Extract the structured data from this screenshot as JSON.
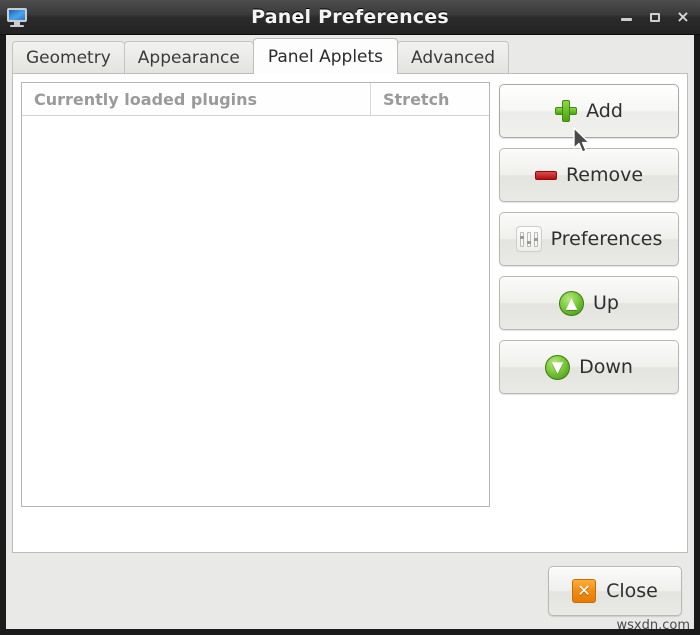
{
  "window": {
    "title": "Panel Preferences",
    "app_icon": "monitor-icon",
    "controls": [
      {
        "name": "minimize",
        "glyph": "minimize-icon"
      },
      {
        "name": "maximize",
        "glyph": "maximize-icon"
      },
      {
        "name": "close",
        "glyph": "close-icon",
        "label": "×"
      }
    ]
  },
  "tabs": [
    {
      "label": "Geometry",
      "active": false
    },
    {
      "label": "Appearance",
      "active": false
    },
    {
      "label": "Panel Applets",
      "active": true
    },
    {
      "label": "Advanced",
      "active": false
    }
  ],
  "plugin_list": {
    "columns": [
      {
        "label": "Currently loaded plugins"
      },
      {
        "label": "Stretch"
      }
    ],
    "rows": []
  },
  "side_buttons": [
    {
      "label": "Add",
      "icon": "plus-icon",
      "hovered": true
    },
    {
      "label": "Remove",
      "icon": "minus-icon",
      "hovered": false
    },
    {
      "label": "Preferences",
      "icon": "sliders-icon",
      "hovered": false
    },
    {
      "label": "Up",
      "icon": "arrow-up-circle-icon",
      "glyph": "▲",
      "hovered": false
    },
    {
      "label": "Down",
      "icon": "arrow-down-circle-icon",
      "glyph": "▼",
      "hovered": false
    }
  ],
  "action_bar": {
    "close_label": "Close",
    "close_icon": "close-x-icon",
    "close_glyph": "✕"
  },
  "watermark": "wsxdn.com",
  "colors": {
    "titlebar_top": "#4e4e4e",
    "titlebar_bottom": "#232323",
    "window_bg": "#e9e9e7",
    "page_bg": "#ffffff",
    "header_text": "#9a9a9a",
    "accent_green": "#4ca211",
    "accent_red": "#b50f0f",
    "accent_orange": "#f08c14"
  }
}
